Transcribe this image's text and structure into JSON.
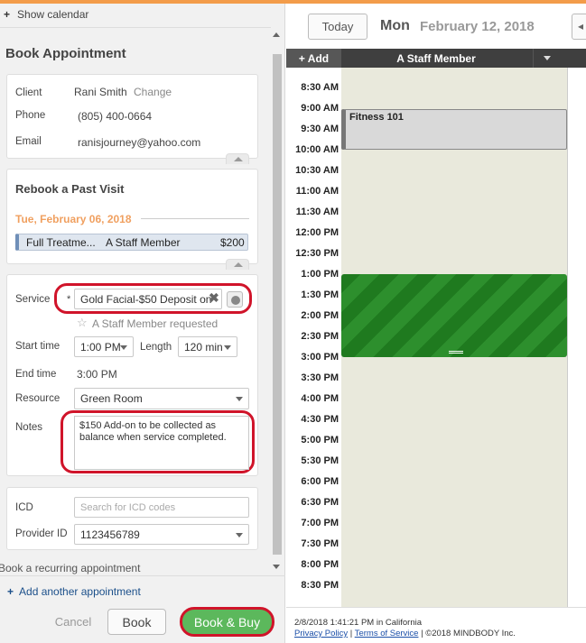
{
  "left": {
    "show_calendar": "Show calendar",
    "title": "Book Appointment",
    "client": {
      "client_label": "Client",
      "client_name": "Rani Smith",
      "change": "Change",
      "phone_label": "Phone",
      "phone": "(805) 400-0664",
      "email_label": "Email",
      "email": "ranisjourney@yahoo.com"
    },
    "rebook": {
      "title": "Rebook a Past Visit",
      "date": "Tue, February 06, 2018",
      "service": "Full Treatme...",
      "staff": "A Staff Member",
      "price": "$200"
    },
    "form": {
      "service_label": "Service",
      "required_mark": "*",
      "service_value": "Gold Facial-$50 Deposit on",
      "staff_requested": "A Staff Member requested",
      "start_label": "Start time",
      "start_value": "1:00 PM",
      "length_label": "Length",
      "length_value": "120 min",
      "end_label": "End time",
      "end_value": "3:00 PM",
      "resource_label": "Resource",
      "resource_value": "Green Room",
      "notes_label": "Notes",
      "notes_value": "$150 Add-on to be collected as balance when service completed."
    },
    "icd": {
      "icd_label": "ICD",
      "icd_placeholder": "Search for ICD codes",
      "provider_label": "Provider ID",
      "provider_value": "1123456789"
    },
    "recurring": "Book a recurring appointment",
    "add_another": "Add another appointment",
    "cancel": "Cancel",
    "book": "Book",
    "book_buy": "Book & Buy"
  },
  "calendar": {
    "today": "Today",
    "day_name": "Mon",
    "date": "February 12, 2018",
    "add": "+ Add",
    "staff": "A Staff Member",
    "times": [
      "8:30 AM",
      "9:00 AM",
      "9:30 AM",
      "10:00 AM",
      "10:30 AM",
      "11:00 AM",
      "11:30 AM",
      "12:00 PM",
      "12:30 PM",
      "1:00 PM",
      "1:30 PM",
      "2:00 PM",
      "2:30 PM",
      "3:00 PM",
      "3:30 PM",
      "4:00 PM",
      "4:30 PM",
      "5:00 PM",
      "5:30 PM",
      "6:00 PM",
      "6:30 PM",
      "7:00 PM",
      "7:30 PM",
      "8:00 PM",
      "8:30 PM"
    ],
    "event_fitness": "Fitness 101"
  },
  "footer": {
    "timestamp": "2/8/2018 1:41:21 PM in California",
    "privacy": "Privacy Policy",
    "sep": " | ",
    "terms": "Terms of Service",
    "copyright": " | ©2018 MINDBODY Inc."
  },
  "colors": {
    "accent_orange": "#f39c4a",
    "green_block": "#1f7a1f",
    "highlight_red": "#d0142a",
    "book_buy_green": "#5cb85c"
  }
}
